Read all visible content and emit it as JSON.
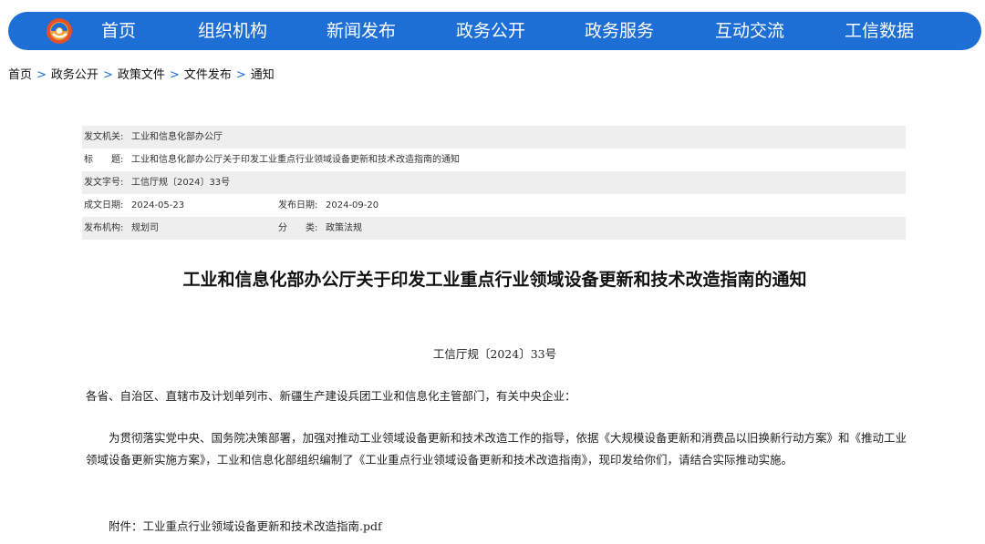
{
  "nav": {
    "items": [
      "首页",
      "组织机构",
      "新闻发布",
      "政务公开",
      "政务服务",
      "互动交流",
      "工信数据"
    ],
    "bg_color": "#1d6fd6",
    "logo_icon": "miit-logo-icon"
  },
  "breadcrumb": [
    "首页",
    "政务公开",
    "政策文件",
    "文件发布",
    "通知"
  ],
  "meta": {
    "issuer_label": "发文机关:",
    "issuer": "工业和信息化部办公厅",
    "title_label": "标　　题:",
    "title": "工业和信息化部办公厅关于印发工业重点行业领域设备更新和技术改造指南的通知",
    "docno_label": "发文字号:",
    "docno": "工信厅规〔2024〕33号",
    "created_label": "成文日期:",
    "created": "2024-05-23",
    "published_label": "发布日期:",
    "published": "2024-09-20",
    "org_label": "发布机构:",
    "org": "规划司",
    "category_label": "分　　类:",
    "category": "政策法规"
  },
  "document": {
    "title": "工业和信息化部办公厅关于印发工业重点行业领域设备更新和技术改造指南的通知",
    "number": "工信厅规〔2024〕33号",
    "recipient": "各省、自治区、直辖市及计划单列市、新疆生产建设兵团工业和信息化主管部门，有关中央企业：",
    "body": "为贯彻落实党中央、国务院决策部署，加强对推动工业领域设备更新和技术改造工作的指导，依据《大规模设备更新和消费品以旧换新行动方案》和《推动工业领域设备更新实施方案》，工业和信息化部组织编制了《工业重点行业领域设备更新和技术改造指南》，现印发给你们，请结合实际推动实施。",
    "attachment": "附件：工业重点行业领域设备更新和技术改造指南.pdf"
  }
}
